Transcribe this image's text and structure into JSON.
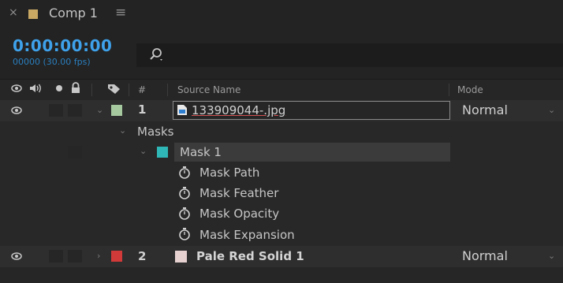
{
  "tab": {
    "close": "×",
    "title": "Comp 1",
    "menu": "≡",
    "swatch_color": "#c9a864"
  },
  "header": {
    "timecode": "0:00:00:00",
    "frames": "00000 (30.00 fps)",
    "search_placeholder": ""
  },
  "columns": {
    "hash": "#",
    "source_name": "Source Name",
    "mode": "Mode"
  },
  "layers": [
    {
      "number": "1",
      "name": "133909044-.jpg",
      "mode": "Normal",
      "label_color": "#a7c9a0",
      "expanded": true
    },
    {
      "number": "2",
      "name": "Pale Red Solid 1",
      "mode": "Normal",
      "label_color": "#d23a3a",
      "swatch_color": "#e6d0d0",
      "expanded": false
    }
  ],
  "masks": {
    "group_label": "Masks",
    "mask1": {
      "label": "Mask 1",
      "color": "#2fb6b6"
    },
    "properties": [
      "Mask Path",
      "Mask Feather",
      "Mask Opacity",
      "Mask Expansion"
    ]
  },
  "colors": {
    "accent": "#3ea1ea",
    "background": "#232323"
  },
  "icons": [
    "close-icon",
    "menu-icon",
    "search-icon",
    "eye-icon",
    "audio-icon",
    "solo-icon",
    "lock-icon",
    "label-tag-icon",
    "chevron-down-icon",
    "chevron-right-icon",
    "stopwatch-icon",
    "image-file-icon"
  ]
}
